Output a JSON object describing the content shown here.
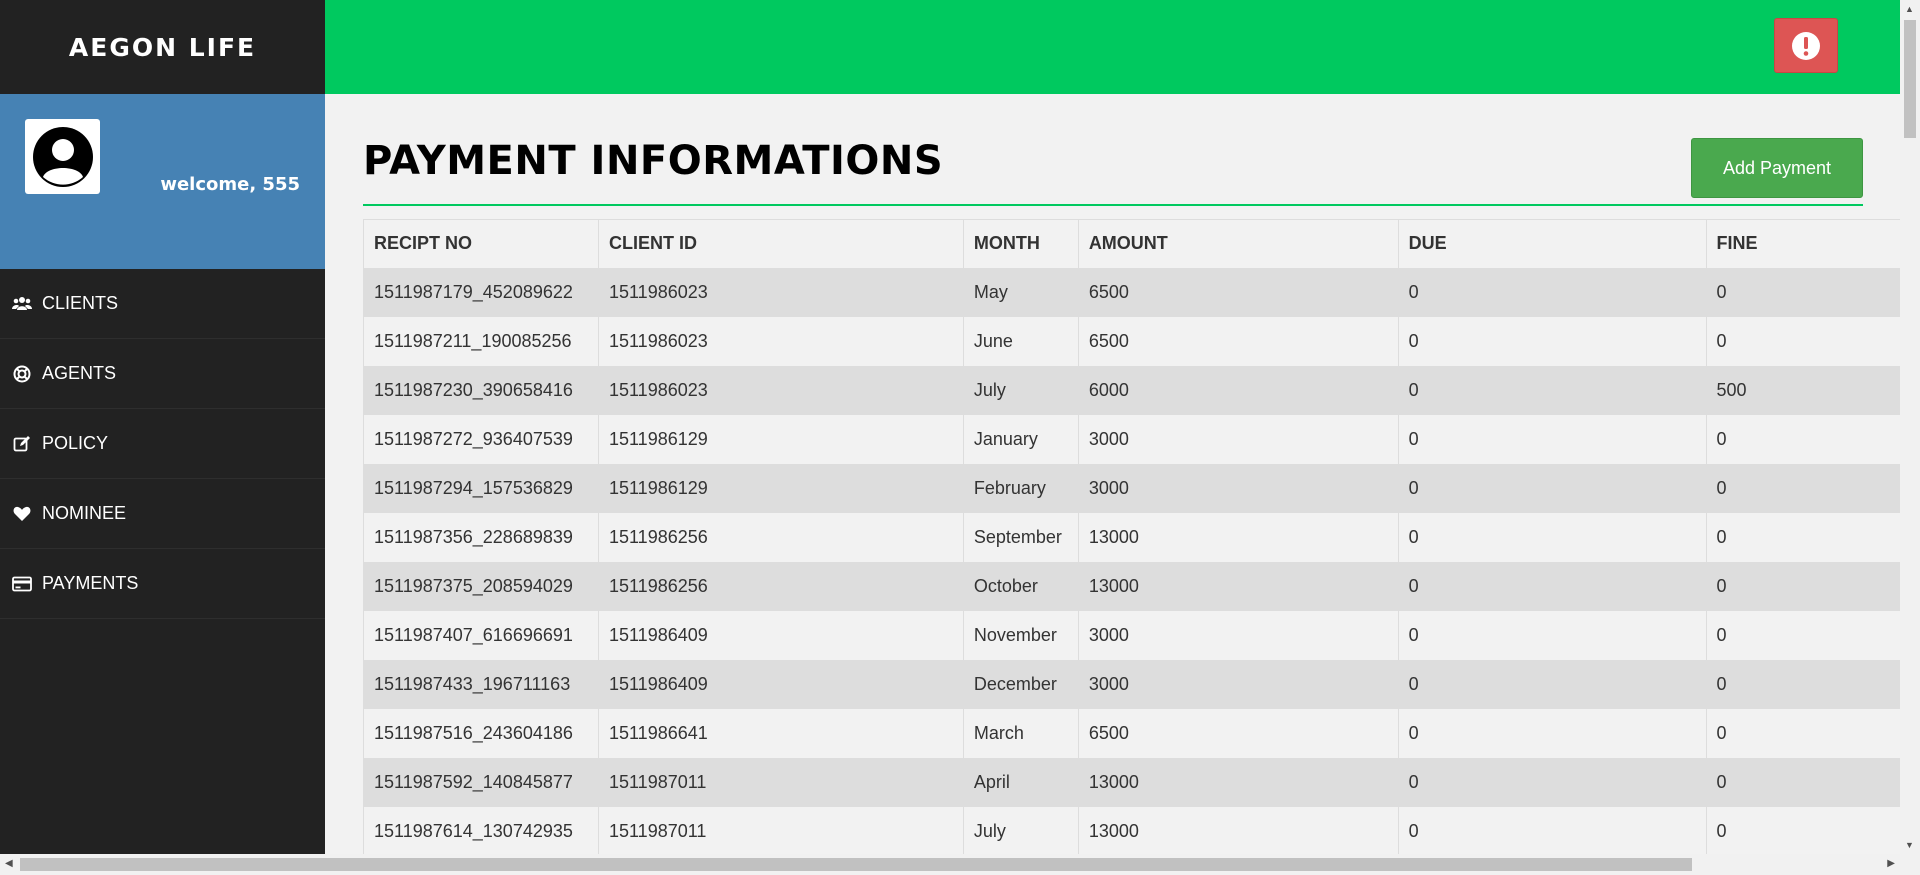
{
  "brand": "AEGON LIFE",
  "profile": {
    "welcome": "welcome, 555"
  },
  "nav": [
    {
      "label": "CLIENTS",
      "icon": "users-icon"
    },
    {
      "label": "AGENTS",
      "icon": "life-ring-icon"
    },
    {
      "label": "POLICY",
      "icon": "edit-icon"
    },
    {
      "label": "NOMINEE",
      "icon": "heart-icon"
    },
    {
      "label": "PAYMENTS",
      "icon": "credit-card-icon"
    }
  ],
  "page_title": "PAYMENT INFORMATIONS",
  "add_button": "Add Payment",
  "columns": [
    "RECIPT NO",
    "CLIENT ID",
    "MONTH",
    "AMOUNT",
    "DUE",
    "FINE"
  ],
  "rows": [
    [
      "1511987179_452089622",
      "1511986023",
      "May",
      "6500",
      "0",
      "0"
    ],
    [
      "1511987211_190085256",
      "1511986023",
      "June",
      "6500",
      "0",
      "0"
    ],
    [
      "1511987230_390658416",
      "1511986023",
      "July",
      "6000",
      "0",
      "500"
    ],
    [
      "1511987272_936407539",
      "1511986129",
      "January",
      "3000",
      "0",
      "0"
    ],
    [
      "1511987294_157536829",
      "1511986129",
      "February",
      "3000",
      "0",
      "0"
    ],
    [
      "1511987356_228689839",
      "1511986256",
      "September",
      "13000",
      "0",
      "0"
    ],
    [
      "1511987375_208594029",
      "1511986256",
      "October",
      "13000",
      "0",
      "0"
    ],
    [
      "1511987407_616696691",
      "1511986409",
      "November",
      "3000",
      "0",
      "0"
    ],
    [
      "1511987433_196711163",
      "1511986409",
      "December",
      "3000",
      "0",
      "0"
    ],
    [
      "1511987516_243604186",
      "1511986641",
      "March",
      "6500",
      "0",
      "0"
    ],
    [
      "1511987592_140845877",
      "1511987011",
      "April",
      "13000",
      "0",
      "0"
    ],
    [
      "1511987614_130742935",
      "1511987011",
      "July",
      "13000",
      "0",
      "0"
    ]
  ],
  "colors": {
    "topbar": "#00c95f",
    "sidebar": "#222222",
    "profile": "#4682b4",
    "alert": "#dd5554",
    "add_button": "#4aa94e"
  }
}
